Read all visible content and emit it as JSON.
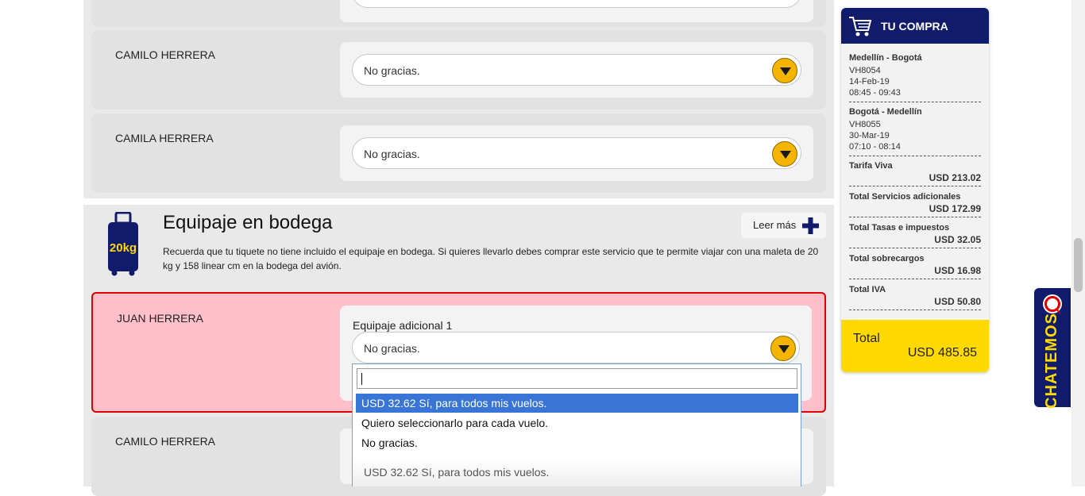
{
  "passengers_top": [
    {
      "name": "CAMILO HERRERA",
      "selection": "No gracias."
    },
    {
      "name": "CAMILA HERRERA",
      "selection": "No gracias."
    }
  ],
  "baggage": {
    "title": "Equipaje en bodega",
    "icon_label": "20kg",
    "read_more": "Leer más",
    "description": "Recuerda que tu tiquete no tiene incluido el equipaje en bodega. Si quieres llevarlo debes comprar este servicio que te permite viajar con una maleta de 20 kg y 158 linear cm en la bodega del avión."
  },
  "active_passenger": {
    "name": "JUAN HERRERA",
    "field_label": "Equipaje adicional 1",
    "selection": "No gracias.",
    "error_color": "#e00000"
  },
  "dropdown": {
    "search_value": "",
    "options": [
      "USD 32.62 Sí, para todos mis vuelos.",
      "Quiero seleccionarlo para cada vuelo.",
      "No gracias."
    ],
    "highlighted_index": 0,
    "footer_option": "USD 32.62 Sí, para todos mis vuelos."
  },
  "bottom_passenger": {
    "name": "CAMILO HERRERA"
  },
  "summary": {
    "title": "TU COMPRA",
    "flights": [
      {
        "route": "Medellín - Bogotá",
        "code": "VH8054",
        "date": "14-Feb-19",
        "time": "08:45 - 09:43"
      },
      {
        "route": "Bogotá - Medellín",
        "code": "VH8055",
        "date": "30-Mar-19",
        "time": "07:10 - 08:14"
      }
    ],
    "lines": [
      {
        "label": "Tarifa Viva",
        "amount": "USD 213.02"
      },
      {
        "label": "Total Servicios adicionales",
        "amount": "USD 172.99"
      },
      {
        "label": "Total Tasas e impuestos",
        "amount": "USD 32.05"
      },
      {
        "label": "Total sobrecargos",
        "amount": "USD 16.98"
      },
      {
        "label": "Total IVA",
        "amount": "USD 50.80"
      }
    ],
    "total_label": "Total",
    "total_amount": "USD 485.85"
  },
  "chat": {
    "label": "CHATEMOS"
  },
  "colors": {
    "navy": "#101c6b",
    "yellow": "#ffd900",
    "highlight": "#3875d7",
    "error_bg": "#ffc0cb"
  }
}
